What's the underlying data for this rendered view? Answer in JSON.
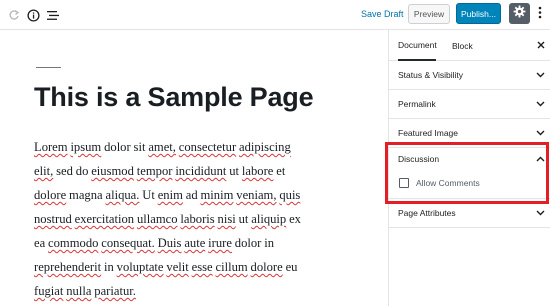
{
  "toolbar": {
    "save_draft_label": "Save Draft",
    "preview_label": "Preview",
    "publish_label": "Publish...",
    "icons": [
      "redo-icon",
      "info-icon",
      "list-view-icon",
      "gear-icon",
      "more-vertical-icon"
    ]
  },
  "editor": {
    "title": "This is a Sample Page",
    "body_lines": [
      " Lorem ipsum dolor sit amet, consectetur adipiscing",
      "elit, sed do eiusmod tempor incididunt ut labore et",
      "dolore magna aliqua. Ut enim ad minim veniam, quis",
      "nostrud exercitation ullamco laboris nisi ut aliquip ex",
      "ea commodo consequat. Duis aute irure dolor in",
      "reprehenderit in voluptate velit esse cillum dolore eu",
      "fugiat nulla pariatur."
    ]
  },
  "sidebar": {
    "tabs": [
      {
        "label": "Document",
        "active": true
      },
      {
        "label": "Block",
        "active": false
      }
    ],
    "panels": [
      {
        "label": "Status & Visibility",
        "expanded": false
      },
      {
        "label": "Permalink",
        "expanded": false
      },
      {
        "label": "Featured Image",
        "expanded": false
      },
      {
        "label": "Discussion",
        "expanded": true
      },
      {
        "label": "Page Attributes",
        "expanded": false
      }
    ],
    "discussion": {
      "allow_comments_label": "Allow Comments",
      "allow_comments_checked": false
    }
  },
  "colors": {
    "accent_blue": "#0085ba",
    "link_blue": "#0073aa",
    "highlight_red": "#e31e24",
    "settings_bg": "#555d66"
  }
}
